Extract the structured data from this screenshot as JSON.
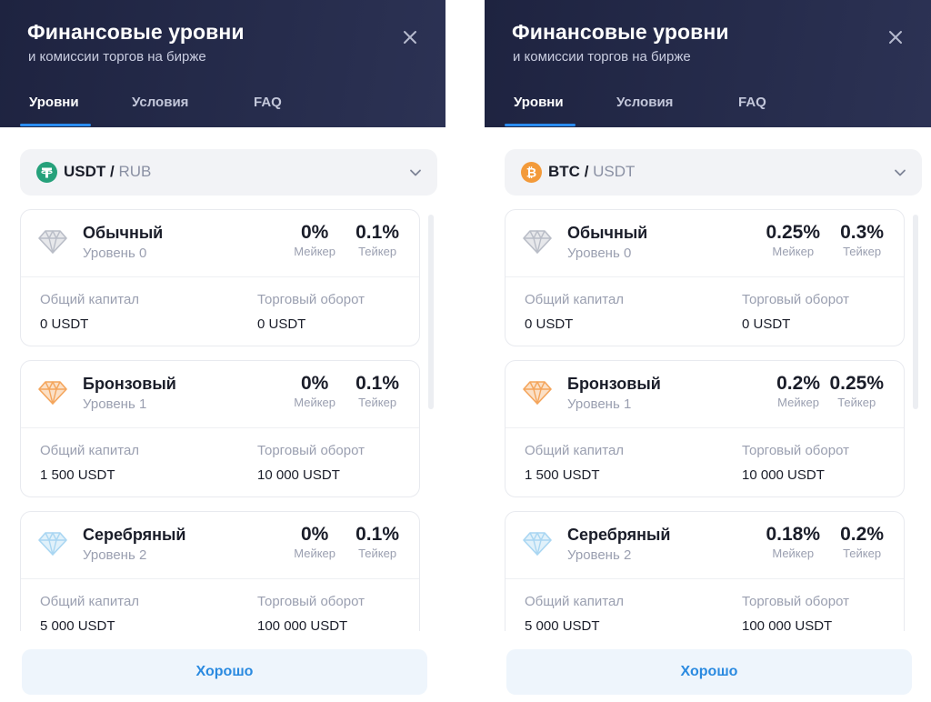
{
  "panels": [
    {
      "title": "Финансовые уровни",
      "subtitle": "и комиссии торгов на бирже",
      "tabs": [
        "Уровни",
        "Условия",
        "FAQ"
      ],
      "active_tab": "Уровни",
      "pair": {
        "base": "USDT",
        "separator": "/",
        "quote": "RUB",
        "coin_icon": "tether-icon",
        "coin_color": "#26a17b"
      },
      "levels": [
        {
          "name": "Обычный",
          "level": "Уровень 0",
          "gem": "diamond-gray-icon",
          "gem_color": "#b9bdc7",
          "maker": "0%",
          "taker": "0.1%",
          "maker_label": "Мейкер",
          "taker_label": "Тейкер",
          "capital_label": "Общий капитал",
          "capital": "0 USDT",
          "turnover_label": "Торговый оборот",
          "turnover": "0 USDT"
        },
        {
          "name": "Бронзовый",
          "level": "Уровень 1",
          "gem": "diamond-bronze-icon",
          "gem_color": "#f4a55c",
          "maker": "0%",
          "taker": "0.1%",
          "maker_label": "Мейкер",
          "taker_label": "Тейкер",
          "capital_label": "Общий капитал",
          "capital": "1 500 USDT",
          "turnover_label": "Торговый оборот",
          "turnover": "10 000 USDT"
        },
        {
          "name": "Серебряный",
          "level": "Уровень 2",
          "gem": "diamond-silver-icon",
          "gem_color": "#a9d6f2",
          "maker": "0%",
          "taker": "0.1%",
          "maker_label": "Мейкер",
          "taker_label": "Тейкер",
          "capital_label": "Общий капитал",
          "capital": "5 000 USDT",
          "turnover_label": "Торговый оборот",
          "turnover": "100 000 USDT"
        }
      ],
      "ok_label": "Хорошо"
    },
    {
      "title": "Финансовые уровни",
      "subtitle": "и комиссии торгов на бирже",
      "tabs": [
        "Уровни",
        "Условия",
        "FAQ"
      ],
      "active_tab": "Уровни",
      "pair": {
        "base": "BTC",
        "separator": "/",
        "quote": "USDT",
        "coin_icon": "bitcoin-icon",
        "coin_color": "#f39a3a"
      },
      "levels": [
        {
          "name": "Обычный",
          "level": "Уровень 0",
          "gem": "diamond-gray-icon",
          "gem_color": "#b9bdc7",
          "maker": "0.25%",
          "taker": "0.3%",
          "maker_label": "Мейкер",
          "taker_label": "Тейкер",
          "capital_label": "Общий капитал",
          "capital": "0 USDT",
          "turnover_label": "Торговый оборот",
          "turnover": "0 USDT"
        },
        {
          "name": "Бронзовый",
          "level": "Уровень 1",
          "gem": "diamond-bronze-icon",
          "gem_color": "#f4a55c",
          "maker": "0.2%",
          "taker": "0.25%",
          "maker_label": "Мейкер",
          "taker_label": "Тейкер",
          "capital_label": "Общий капитал",
          "capital": "1 500 USDT",
          "turnover_label": "Торговый оборот",
          "turnover": "10 000 USDT"
        },
        {
          "name": "Серебряный",
          "level": "Уровень 2",
          "gem": "diamond-silver-icon",
          "gem_color": "#a9d6f2",
          "maker": "0.18%",
          "taker": "0.2%",
          "maker_label": "Мейкер",
          "taker_label": "Тейкер",
          "capital_label": "Общий капитал",
          "capital": "5 000 USDT",
          "turnover_label": "Торговый оборот",
          "turnover": "100 000 USDT"
        }
      ],
      "ok_label": "Хорошо"
    }
  ],
  "colors": {
    "header_bg": "#1e2340",
    "accent": "#2a8cf0",
    "button_bg": "#eef5fc",
    "button_text": "#2a8ae0"
  }
}
